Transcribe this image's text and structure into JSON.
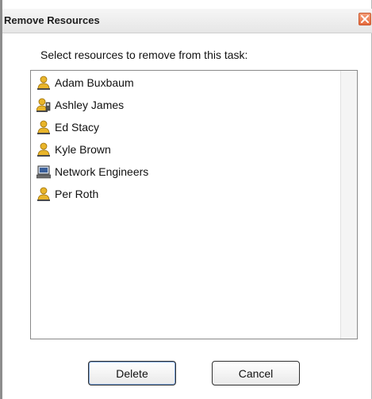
{
  "dialog": {
    "title": "Remove Resources",
    "prompt": "Select resources to remove from this task:",
    "resources": [
      {
        "label": "Adam Buxbaum",
        "icon": "person-icon"
      },
      {
        "label": "Ashley James",
        "icon": "person-phone-icon"
      },
      {
        "label": "Ed Stacy",
        "icon": "person-icon"
      },
      {
        "label": "Kyle Brown",
        "icon": "person-icon"
      },
      {
        "label": "Network Engineers",
        "icon": "computer-icon"
      },
      {
        "label": "Per Roth",
        "icon": "person-icon"
      }
    ],
    "buttons": {
      "delete": "Delete",
      "cancel": "Cancel"
    }
  },
  "colors": {
    "person_icon": "#e9b52a",
    "title_bar": "#eeeeee",
    "close_button": "#e8774a"
  }
}
